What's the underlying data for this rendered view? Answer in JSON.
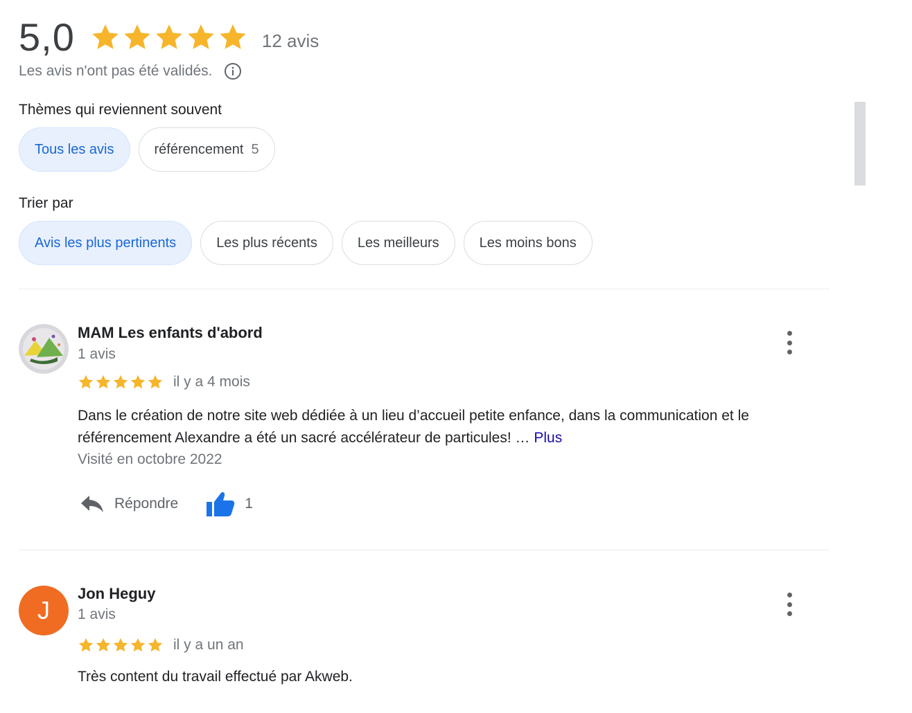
{
  "summary": {
    "rating": "5,0",
    "stars": 5,
    "count_label": "12 avis",
    "note": "Les avis n'ont pas été validés.",
    "star_color": "#f6b52a"
  },
  "topics": {
    "title": "Thèmes qui reviennent souvent",
    "chips": [
      {
        "label": "Tous les avis",
        "count": "",
        "active": true
      },
      {
        "label": "référencement",
        "count": "5",
        "active": false
      }
    ]
  },
  "sort": {
    "title": "Trier par",
    "chips": [
      {
        "label": "Avis les plus pertinents",
        "active": true
      },
      {
        "label": "Les plus récents",
        "active": false
      },
      {
        "label": "Les meilleurs",
        "active": false
      },
      {
        "label": "Les moins bons",
        "active": false
      }
    ]
  },
  "reviews": [
    {
      "name": "MAM Les enfants d'abord",
      "meta": "1 avis",
      "stars": 5,
      "date": "il y a 4 mois",
      "text": "Dans le création de notre site web dédiée à un lieu d’accueil petite enfance, dans la communication et le référencement Alexandre a été un sacré accélérateur de particules! … ",
      "more_label": "Plus",
      "visited": "Visité en octobre 2022",
      "reply_label": "Répondre",
      "likes": "1",
      "avatar_type": "image"
    },
    {
      "name": "Jon Heguy",
      "meta": "1 avis",
      "stars": 5,
      "date": "il y a un an",
      "text": "Très content du travail effectué par Akweb.",
      "avatar_type": "initial",
      "avatar_initial": "J",
      "avatar_color": "#ef6c22"
    }
  ],
  "icons": {
    "info": "info-icon",
    "reply": "reply-icon",
    "like": "thumbs-up-icon",
    "menu": "more-vert-icon",
    "star": "star-icon"
  }
}
